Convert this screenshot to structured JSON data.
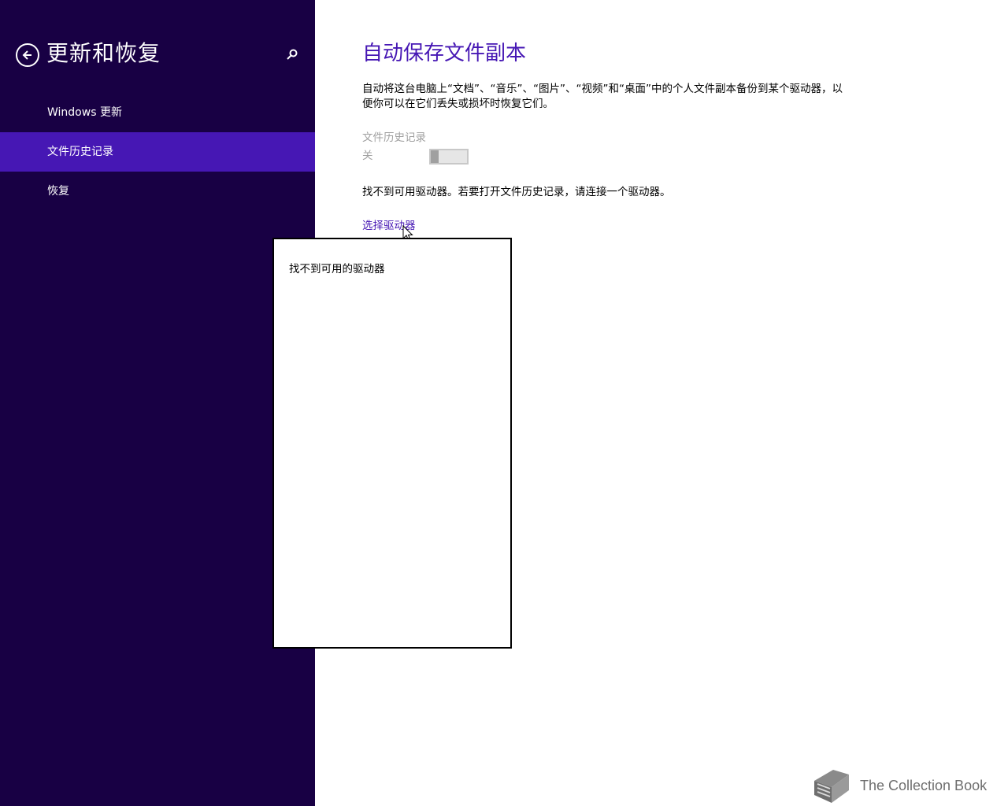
{
  "sidebar": {
    "title": "更新和恢复",
    "items": [
      {
        "label": "Windows 更新"
      },
      {
        "label": "文件历史记录"
      },
      {
        "label": "恢复"
      }
    ],
    "selected_index": 1
  },
  "main": {
    "title": "自动保存文件副本",
    "description": "自动将这台电脑上“文档”、“音乐”、“图片”、“视频”和“桌面”中的个人文件副本备份到某个驱动器，以便你可以在它们丢失或损坏时恢复它们。",
    "setting_label": "文件历史记录",
    "toggle_state": "关",
    "toggle_on": false,
    "no_drive_message": "找不到可用驱动器。若要打开文件历史记录，请连接一个驱动器。",
    "select_drive_link": "选择驱动器"
  },
  "flyout": {
    "message": "找不到可用的驱动器"
  },
  "watermark": {
    "text": "The Collection Book"
  },
  "colors": {
    "sidebar_bg": "#180044",
    "accent": "#4617b4",
    "disabled_text": "#a0a0a0"
  },
  "icons": {
    "back": "back-arrow-circle-icon",
    "search": "search-icon",
    "pointer": "mouse-pointer-icon",
    "watermark": "book-icon"
  }
}
